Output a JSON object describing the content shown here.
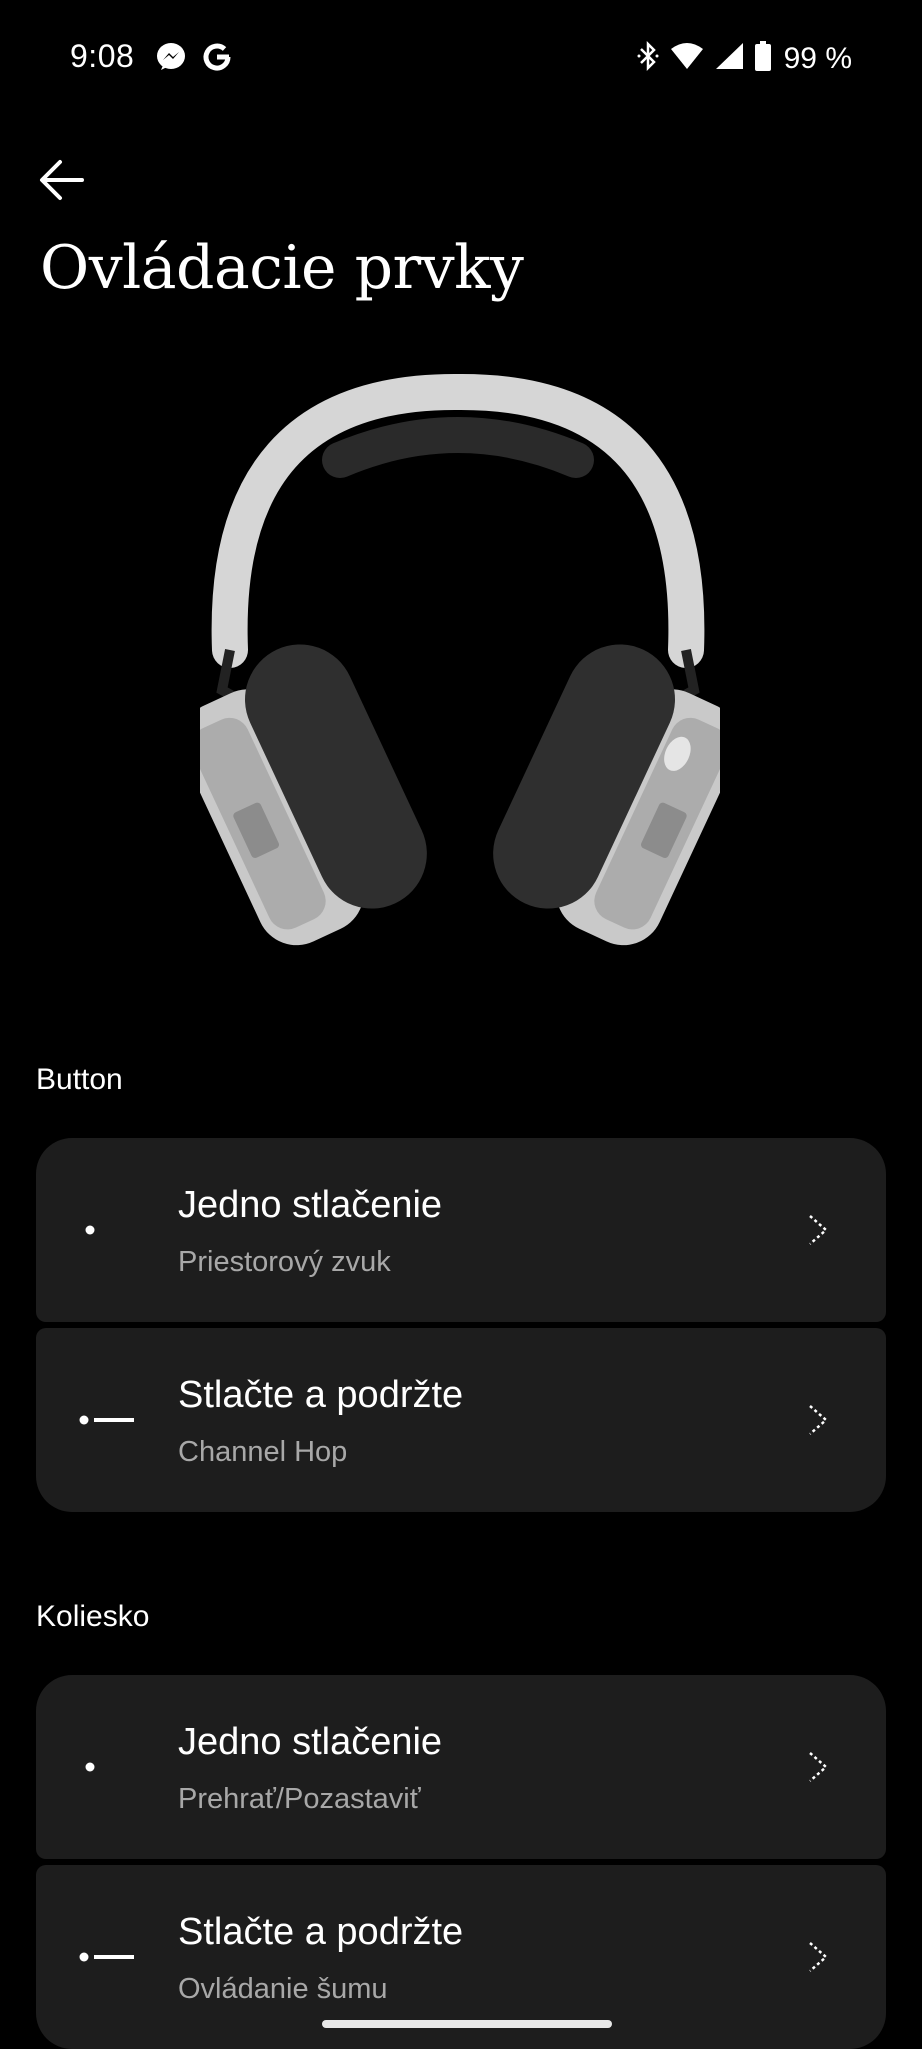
{
  "status_bar": {
    "time": "9:08",
    "battery_text": "99 %",
    "left_icons": [
      "messenger-icon",
      "google-icon"
    ],
    "right_icons": [
      "bluetooth-icon",
      "wifi-icon",
      "signal-icon",
      "battery-icon"
    ]
  },
  "header": {
    "back_icon": "arrow-left-icon",
    "title": "Ovládacie prvky"
  },
  "hero": {
    "image": "headphones-image"
  },
  "sections": {
    "button": {
      "label": "Button",
      "items": [
        {
          "title": "Jedno stlačenie",
          "subtitle": "Priestorový zvuk",
          "icon": "single-press-icon"
        },
        {
          "title": "Stlačte a podržte",
          "subtitle": "Channel Hop",
          "icon": "press-hold-icon"
        }
      ]
    },
    "wheel": {
      "label": "Koliesko",
      "items": [
        {
          "title": "Jedno stlačenie",
          "subtitle": "Prehrať/Pozastaviť",
          "icon": "single-press-icon"
        },
        {
          "title": "Stlačte a podržte",
          "subtitle": "Ovládanie šumu",
          "icon": "press-hold-icon"
        }
      ]
    }
  },
  "colors": {
    "background": "#000000",
    "card": "#1d1d1d",
    "text": "#ffffff",
    "subtext": "#a8a8a8"
  }
}
